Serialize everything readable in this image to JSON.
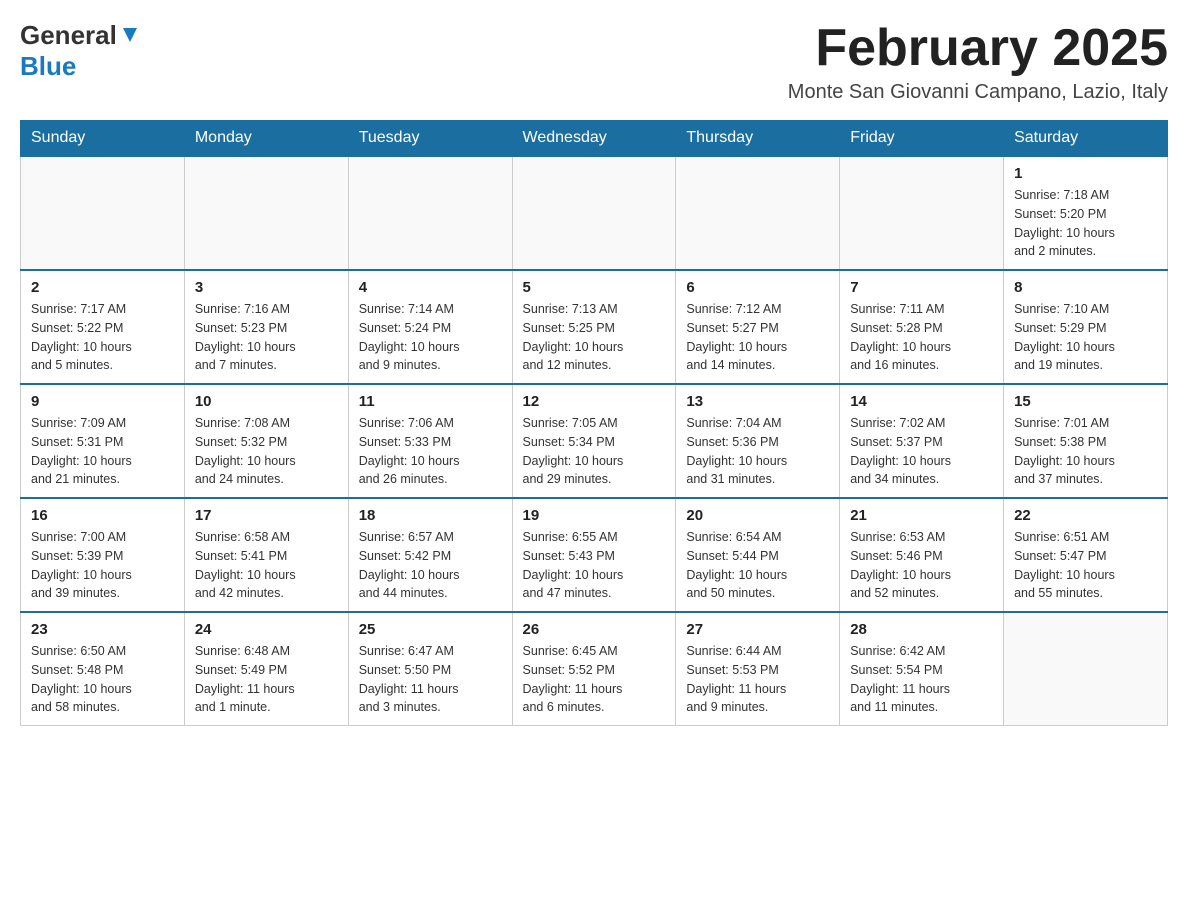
{
  "header": {
    "logo_general": "General",
    "logo_blue": "Blue",
    "month_title": "February 2025",
    "location": "Monte San Giovanni Campano, Lazio, Italy"
  },
  "days_of_week": [
    "Sunday",
    "Monday",
    "Tuesday",
    "Wednesday",
    "Thursday",
    "Friday",
    "Saturday"
  ],
  "weeks": [
    [
      {
        "day": "",
        "info": ""
      },
      {
        "day": "",
        "info": ""
      },
      {
        "day": "",
        "info": ""
      },
      {
        "day": "",
        "info": ""
      },
      {
        "day": "",
        "info": ""
      },
      {
        "day": "",
        "info": ""
      },
      {
        "day": "1",
        "info": "Sunrise: 7:18 AM\nSunset: 5:20 PM\nDaylight: 10 hours\nand 2 minutes."
      }
    ],
    [
      {
        "day": "2",
        "info": "Sunrise: 7:17 AM\nSunset: 5:22 PM\nDaylight: 10 hours\nand 5 minutes."
      },
      {
        "day": "3",
        "info": "Sunrise: 7:16 AM\nSunset: 5:23 PM\nDaylight: 10 hours\nand 7 minutes."
      },
      {
        "day": "4",
        "info": "Sunrise: 7:14 AM\nSunset: 5:24 PM\nDaylight: 10 hours\nand 9 minutes."
      },
      {
        "day": "5",
        "info": "Sunrise: 7:13 AM\nSunset: 5:25 PM\nDaylight: 10 hours\nand 12 minutes."
      },
      {
        "day": "6",
        "info": "Sunrise: 7:12 AM\nSunset: 5:27 PM\nDaylight: 10 hours\nand 14 minutes."
      },
      {
        "day": "7",
        "info": "Sunrise: 7:11 AM\nSunset: 5:28 PM\nDaylight: 10 hours\nand 16 minutes."
      },
      {
        "day": "8",
        "info": "Sunrise: 7:10 AM\nSunset: 5:29 PM\nDaylight: 10 hours\nand 19 minutes."
      }
    ],
    [
      {
        "day": "9",
        "info": "Sunrise: 7:09 AM\nSunset: 5:31 PM\nDaylight: 10 hours\nand 21 minutes."
      },
      {
        "day": "10",
        "info": "Sunrise: 7:08 AM\nSunset: 5:32 PM\nDaylight: 10 hours\nand 24 minutes."
      },
      {
        "day": "11",
        "info": "Sunrise: 7:06 AM\nSunset: 5:33 PM\nDaylight: 10 hours\nand 26 minutes."
      },
      {
        "day": "12",
        "info": "Sunrise: 7:05 AM\nSunset: 5:34 PM\nDaylight: 10 hours\nand 29 minutes."
      },
      {
        "day": "13",
        "info": "Sunrise: 7:04 AM\nSunset: 5:36 PM\nDaylight: 10 hours\nand 31 minutes."
      },
      {
        "day": "14",
        "info": "Sunrise: 7:02 AM\nSunset: 5:37 PM\nDaylight: 10 hours\nand 34 minutes."
      },
      {
        "day": "15",
        "info": "Sunrise: 7:01 AM\nSunset: 5:38 PM\nDaylight: 10 hours\nand 37 minutes."
      }
    ],
    [
      {
        "day": "16",
        "info": "Sunrise: 7:00 AM\nSunset: 5:39 PM\nDaylight: 10 hours\nand 39 minutes."
      },
      {
        "day": "17",
        "info": "Sunrise: 6:58 AM\nSunset: 5:41 PM\nDaylight: 10 hours\nand 42 minutes."
      },
      {
        "day": "18",
        "info": "Sunrise: 6:57 AM\nSunset: 5:42 PM\nDaylight: 10 hours\nand 44 minutes."
      },
      {
        "day": "19",
        "info": "Sunrise: 6:55 AM\nSunset: 5:43 PM\nDaylight: 10 hours\nand 47 minutes."
      },
      {
        "day": "20",
        "info": "Sunrise: 6:54 AM\nSunset: 5:44 PM\nDaylight: 10 hours\nand 50 minutes."
      },
      {
        "day": "21",
        "info": "Sunrise: 6:53 AM\nSunset: 5:46 PM\nDaylight: 10 hours\nand 52 minutes."
      },
      {
        "day": "22",
        "info": "Sunrise: 6:51 AM\nSunset: 5:47 PM\nDaylight: 10 hours\nand 55 minutes."
      }
    ],
    [
      {
        "day": "23",
        "info": "Sunrise: 6:50 AM\nSunset: 5:48 PM\nDaylight: 10 hours\nand 58 minutes."
      },
      {
        "day": "24",
        "info": "Sunrise: 6:48 AM\nSunset: 5:49 PM\nDaylight: 11 hours\nand 1 minute."
      },
      {
        "day": "25",
        "info": "Sunrise: 6:47 AM\nSunset: 5:50 PM\nDaylight: 11 hours\nand 3 minutes."
      },
      {
        "day": "26",
        "info": "Sunrise: 6:45 AM\nSunset: 5:52 PM\nDaylight: 11 hours\nand 6 minutes."
      },
      {
        "day": "27",
        "info": "Sunrise: 6:44 AM\nSunset: 5:53 PM\nDaylight: 11 hours\nand 9 minutes."
      },
      {
        "day": "28",
        "info": "Sunrise: 6:42 AM\nSunset: 5:54 PM\nDaylight: 11 hours\nand 11 minutes."
      },
      {
        "day": "",
        "info": ""
      }
    ]
  ]
}
